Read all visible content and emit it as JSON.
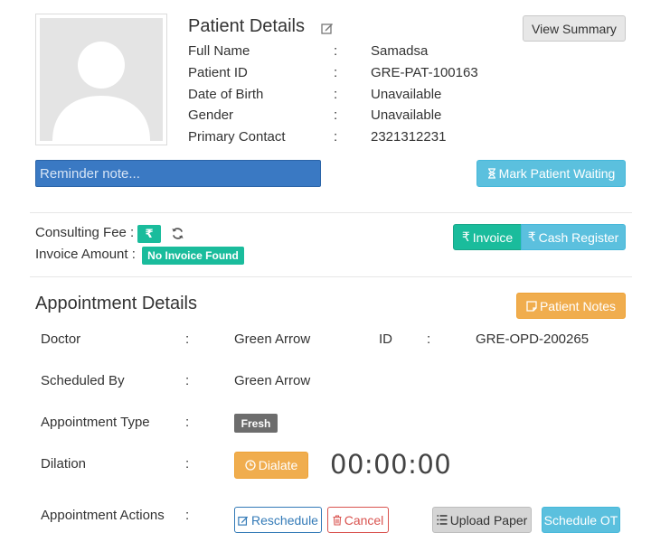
{
  "patient": {
    "title": "Patient Details",
    "view_summary_label": "View Summary",
    "fields": [
      {
        "label": "Full Name",
        "value": "Samadsa"
      },
      {
        "label": "Patient ID",
        "value": "GRE-PAT-100163"
      },
      {
        "label": "Date of Birth",
        "value": "Unavailable"
      },
      {
        "label": "Gender",
        "value": "Unavailable"
      },
      {
        "label": "Primary Contact",
        "value": "2321312231"
      }
    ],
    "colon": ":"
  },
  "reminder": {
    "placeholder": "Reminder note..."
  },
  "mark_waiting_label": "Mark Patient Waiting",
  "billing": {
    "consulting_fee_label": "Consulting Fee :",
    "rupee_symbol": "₹",
    "invoice_amount_label": "Invoice Amount :",
    "no_invoice_badge": "No Invoice Found",
    "invoice_button": "Invoice",
    "cash_register_button": "Cash Register"
  },
  "appointment": {
    "title": "Appointment Details",
    "patient_notes_label": "Patient Notes",
    "doctor_label": "Doctor",
    "doctor_value": "Green Arrow",
    "id_label": "ID",
    "id_value": "GRE-OPD-200265",
    "scheduled_by_label": "Scheduled By",
    "scheduled_by_value": "Green Arrow",
    "type_label": "Appointment Type",
    "type_badge": "Fresh",
    "dilation_label": "Dilation",
    "dilate_button": "Dialate",
    "timer": "00:00:00",
    "actions_label": "Appointment Actions",
    "reschedule_button": "Reschedule",
    "cancel_button": "Cancel",
    "upload_paper_button": "Upload Paper",
    "schedule_ot_button": "Schedule OT"
  },
  "colors": {
    "info": "#5bc0de",
    "success": "#1abc9c",
    "warning": "#f0ad4e",
    "reminder_bg": "#3a79c3"
  },
  "icons": [
    "user-silhouette-icon",
    "edit-icon",
    "hourglass-icon",
    "refresh-icon",
    "rupee-icon",
    "notes-icon",
    "clock-icon",
    "trash-icon",
    "list-icon"
  ]
}
